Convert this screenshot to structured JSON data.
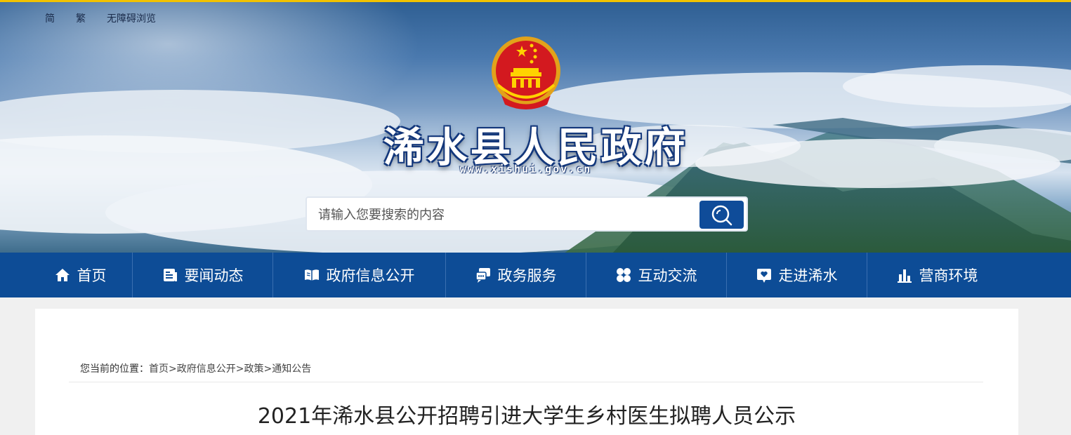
{
  "top_links": [
    "简",
    "繁",
    "无障碍浏览"
  ],
  "site": {
    "title": "浠水县人民政府",
    "url": "www.xishui.gov.cn"
  },
  "search": {
    "placeholder": "请输入您要搜索的内容",
    "button_icon": "search-icon"
  },
  "nav": {
    "items": [
      {
        "label": "首页",
        "icon": "home-icon"
      },
      {
        "label": "要闻动态",
        "icon": "news-icon"
      },
      {
        "label": "政府信息公开",
        "icon": "open-book-icon"
      },
      {
        "label": "政务服务",
        "icon": "service-chat-icon"
      },
      {
        "label": "互动交流",
        "icon": "grid-dots-icon"
      },
      {
        "label": "走进浠水",
        "icon": "heart-map-icon"
      },
      {
        "label": "营商环境",
        "icon": "bar-chart-icon"
      }
    ]
  },
  "breadcrumb": {
    "prefix": "您当前的位置：",
    "items": [
      "首页",
      "政府信息公开",
      "政策",
      "通知公告"
    ],
    "separator": ">"
  },
  "article": {
    "title": "2021年浠水县公开招聘引进大学生乡村医生拟聘人员公示"
  },
  "colors": {
    "nav_bg": "#0d4c96",
    "accent_top": "#f2c200",
    "search_button": "#0f4c99"
  }
}
